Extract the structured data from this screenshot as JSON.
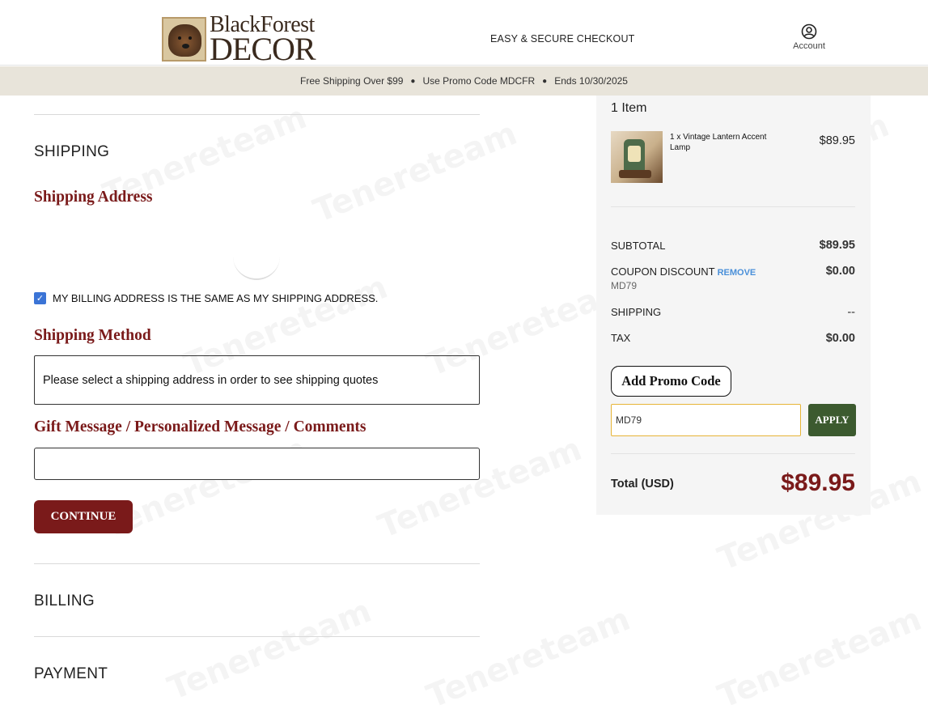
{
  "header": {
    "logo_line1": "BlackForest",
    "logo_line2": "DECOR",
    "secure_text": "EASY & SECURE CHECKOUT",
    "account_label": "Account"
  },
  "promo_bar": {
    "items": [
      "Free Shipping Over $99",
      "Use Promo Code MDCFR",
      "Ends 10/30/2025"
    ]
  },
  "checkout": {
    "shipping_heading": "SHIPPING",
    "shipping_address_heading": "Shipping Address",
    "billing_same_label": "MY BILLING ADDRESS IS THE SAME AS MY SHIPPING ADDRESS.",
    "billing_same_checked": true,
    "shipping_method_heading": "Shipping Method",
    "shipping_method_message": "Please select a shipping address in order to see shipping quotes",
    "gift_message_heading": "Gift Message / Personalized Message / Comments",
    "gift_message_value": "",
    "continue_label": "CONTINUE",
    "billing_heading": "BILLING",
    "payment_heading": "PAYMENT"
  },
  "summary": {
    "item_count": "1 Item",
    "items": [
      {
        "name": "1 x Vintage Lantern Accent Lamp",
        "price": "$89.95"
      }
    ],
    "subtotal_label": "SUBTOTAL",
    "subtotal": "$89.95",
    "coupon_label": "COUPON DISCOUNT",
    "coupon_remove": "REMOVE",
    "coupon_code": "MD79",
    "coupon_value": "$0.00",
    "shipping_label": "SHIPPING",
    "shipping_value": "--",
    "tax_label": "TAX",
    "tax_value": "$0.00",
    "add_promo_label": "Add Promo Code",
    "promo_input_value": "MD79",
    "apply_label": "APPLY",
    "total_label": "Total (USD)",
    "total_value": "$89.95"
  },
  "watermark": "Tenereteam",
  "colors": {
    "brand_red": "#7a1a1a",
    "apply_green": "#3c5a2f",
    "checkbox_blue": "#3b74d6",
    "promo_bar_bg": "#e8e4da",
    "remove_link": "#4a90d9"
  }
}
